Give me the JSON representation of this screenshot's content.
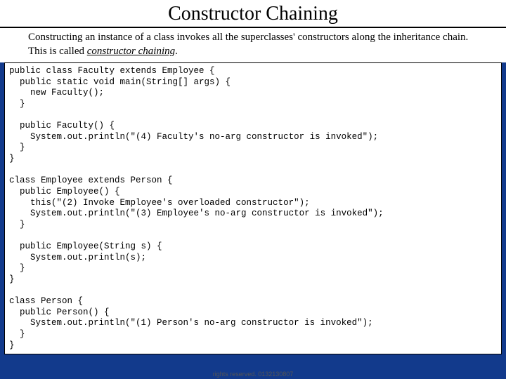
{
  "title": "Constructor Chaining",
  "subtitle": {
    "pre": "Constructing an instance of a class invokes all the superclasses' constructors along the inheritance chain. This is called ",
    "emph": "constructor chaining",
    "post": "."
  },
  "code": "public class Faculty extends Employee {\n  public static void main(String[] args) {\n    new Faculty();\n  }\n\n  public Faculty() {\n    System.out.println(\"(4) Faculty's no-arg constructor is invoked\");\n  }\n}\n\nclass Employee extends Person {\n  public Employee() {\n    this(\"(2) Invoke Employee's overloaded constructor\");\n    System.out.println(\"(3) Employee's no-arg constructor is invoked\");\n  }\n\n  public Employee(String s) {\n    System.out.println(s);\n  }\n}\n\nclass Person {\n  public Person() {\n    System.out.println(\"(1) Person's no-arg constructor is invoked\");\n  }\n}",
  "footer": "rights reserved. 0132130807"
}
